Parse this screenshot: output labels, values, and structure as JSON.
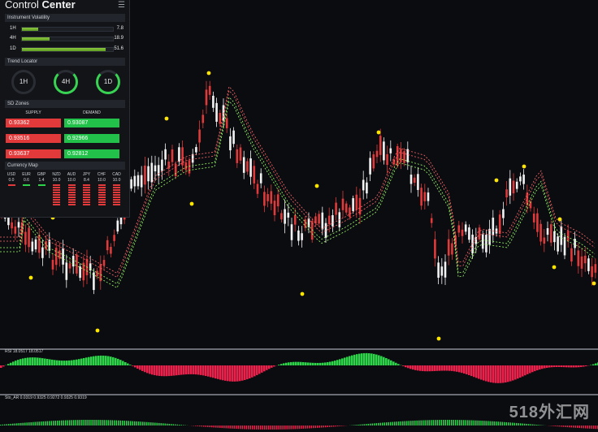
{
  "panel": {
    "title_light": "Control ",
    "title_bold": "Center",
    "instrument_volatility": {
      "header": "Instrument Volatility",
      "rows": [
        {
          "label": "1H",
          "value": "7.8",
          "fill": 0.18
        },
        {
          "label": "4H",
          "value": "18.9",
          "fill": 0.3
        },
        {
          "label": "1D",
          "value": "51.6",
          "fill": 0.92
        }
      ]
    },
    "trend_locator": {
      "header": "Trend Locator",
      "rings": [
        {
          "label": "1H",
          "active": false
        },
        {
          "label": "4H",
          "active": true
        },
        {
          "label": "1D",
          "active": true
        }
      ]
    },
    "sd_zones": {
      "header": "SD Zones",
      "supply_label": "SUPPLY",
      "demand_label": "DEMAND",
      "supply": [
        "0.93362",
        "0.93516",
        "0.93637"
      ],
      "demand": [
        "0.93087",
        "0.92966",
        "0.92812"
      ]
    },
    "currency_map": {
      "header": "Currency Map",
      "items": [
        {
          "code": "USD",
          "value": "0.0"
        },
        {
          "code": "EUR",
          "value": "0.6"
        },
        {
          "code": "GBP",
          "value": "1.4"
        },
        {
          "code": "NZD",
          "value": "10.0"
        },
        {
          "code": "AUD",
          "value": "10.0"
        },
        {
          "code": "JPY",
          "value": "8.4"
        },
        {
          "code": "CHF",
          "value": "10.0"
        },
        {
          "code": "CAD",
          "value": "10.0"
        }
      ]
    }
  },
  "indicators": {
    "rsi_label": "RSI 18.0517 18.0517",
    "osc_label": "Sto_AR 0.0319 0.9325 0.9272 0.9325 0.9319"
  },
  "watermark": "518外汇网",
  "colors": {
    "bull": "#f2f2f2",
    "bear": "#e23a3a",
    "green": "#2fd34a",
    "red": "#e8224a",
    "dot": "#ffe600"
  }
}
